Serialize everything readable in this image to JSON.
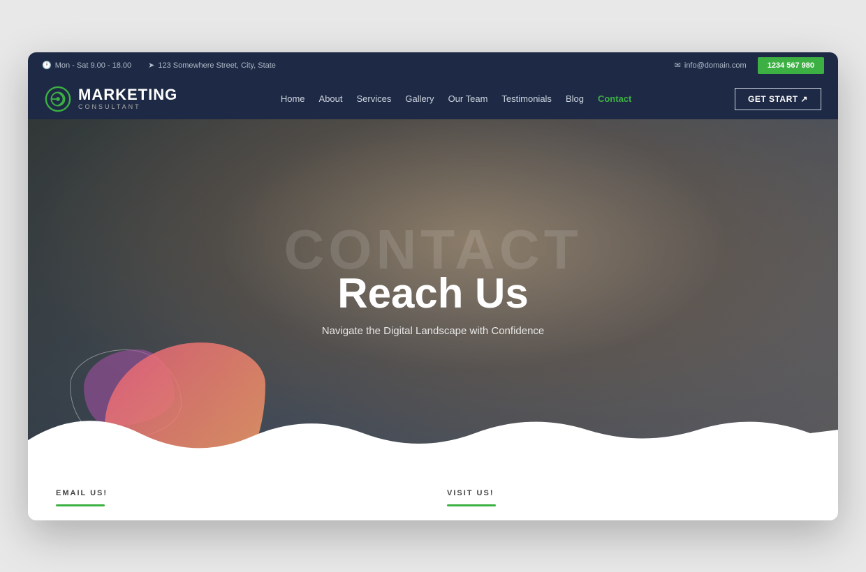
{
  "topbar": {
    "hours": "Mon - Sat 9.00 - 18.00",
    "address": "123 Somewhere Street, City, State",
    "email": "info@domain.com",
    "phone": "1234 567 980"
  },
  "navbar": {
    "logo_main": "MARKETING",
    "logo_sub": "CONSULTANT",
    "links": [
      {
        "label": "Home",
        "active": false
      },
      {
        "label": "About",
        "active": false
      },
      {
        "label": "Services",
        "active": false
      },
      {
        "label": "Gallery",
        "active": false
      },
      {
        "label": "Our Team",
        "active": false
      },
      {
        "label": "Testimonials",
        "active": false
      },
      {
        "label": "Blog",
        "active": false
      },
      {
        "label": "Contact",
        "active": true
      }
    ],
    "cta_label": "GET START ↗"
  },
  "hero": {
    "watermark": "CONTACT",
    "title": "Reach Us",
    "subtitle": "Navigate the Digital Landscape with Confidence"
  },
  "below": {
    "email_label": "EMAIL US!",
    "visit_label": "VISIT US!"
  },
  "colors": {
    "dark_navy": "#1e2a45",
    "green": "#3cb043",
    "pink_start": "#e8607a",
    "pink_end": "#f0a060",
    "purple": "rgba(160,80,160,0.6)"
  }
}
